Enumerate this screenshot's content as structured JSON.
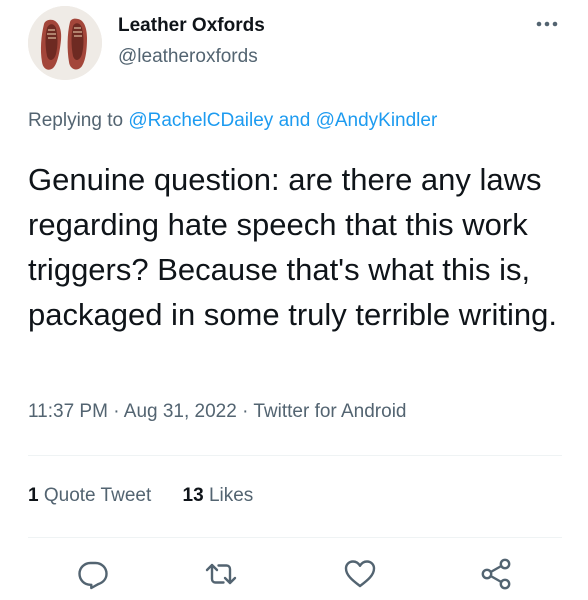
{
  "tweet": {
    "display_name": "Leather Oxfords",
    "handle": "@leatheroxfords",
    "avatar_icon": "shoes-avatar",
    "replying_prefix": "Replying to",
    "replying_to_1": "@RachelCDailey",
    "replying_and": "and",
    "replying_to_2": "@AndyKindler",
    "text": "Genuine question: are there any laws regarding hate speech that this work triggers? Because that's what this is, packaged in some truly terrible writing.",
    "time": "11:37 PM",
    "date": "Aug 31, 2022",
    "source": "Twitter for Android",
    "separator": "·"
  },
  "stats": {
    "quote_count": "1",
    "quote_label": "Quote Tweet",
    "likes_count": "13",
    "likes_label": "Likes"
  },
  "actions": {
    "reply": "reply-icon",
    "retweet": "retweet-icon",
    "like": "like-icon",
    "share": "share-icon",
    "more": "more-icon"
  },
  "colors": {
    "text": "#0f1419",
    "secondary": "#536471",
    "link": "#1d9bf0"
  }
}
